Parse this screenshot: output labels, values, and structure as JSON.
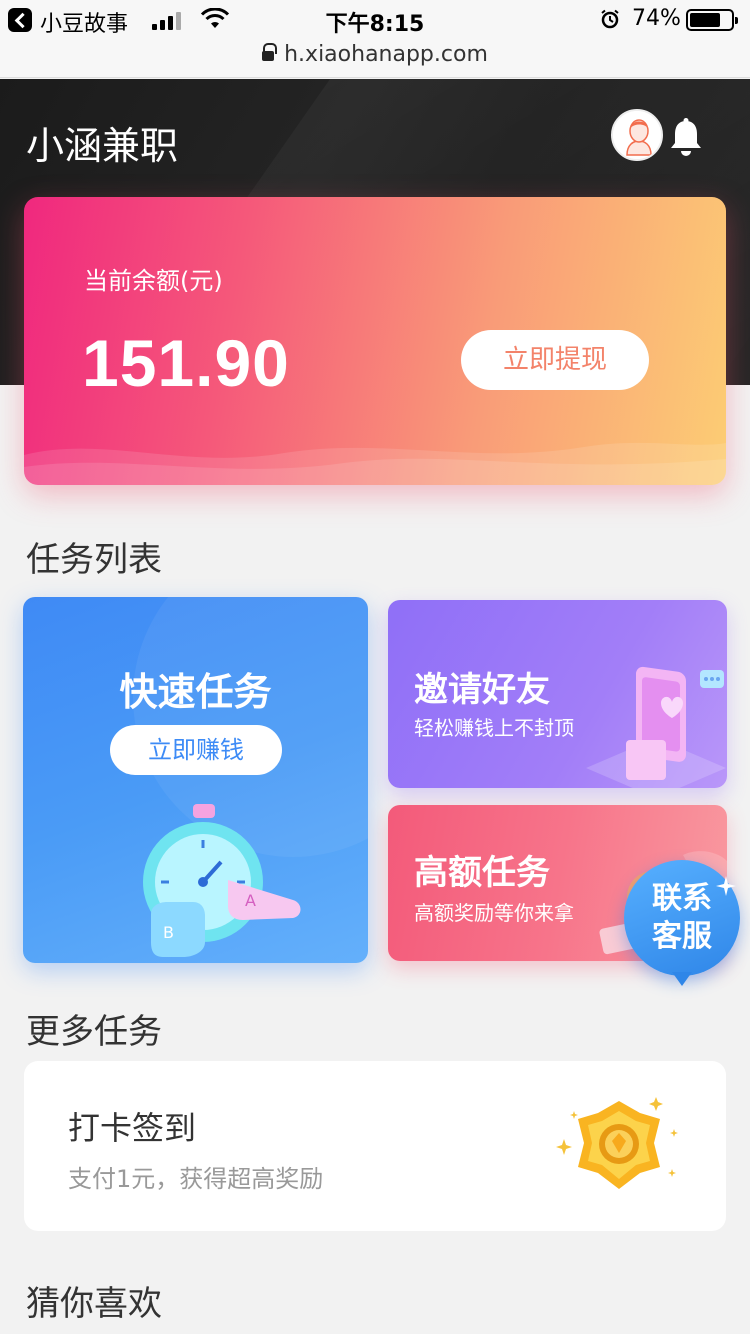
{
  "statusbar": {
    "carrier": "小豆故事",
    "time": "下午8:15",
    "battery_pct": "74%",
    "battery_level": 0.74
  },
  "urlbar": {
    "url": "h.xiaohanapp.com"
  },
  "header": {
    "title": "小涵兼职"
  },
  "balance": {
    "label": "当前余额(元)",
    "value": "151.90",
    "withdraw_label": "立即提现"
  },
  "sections": {
    "tasks": "任务列表",
    "more": "更多任务",
    "guess": "猜你喜欢"
  },
  "tasks": {
    "quick": {
      "title": "快速任务",
      "button": "立即赚钱"
    },
    "invite": {
      "title": "邀请好友",
      "subtitle": "轻松赚钱上不封顶"
    },
    "high": {
      "title": "高额任务",
      "subtitle": "高额奖励等你来拿"
    }
  },
  "customer_service": {
    "line1": "联系",
    "line2": "客服"
  },
  "checkin": {
    "title": "打卡签到",
    "subtitle": "支付1元，获得超高奖励"
  },
  "colors": {
    "balance_gradient_start": "#f0287e",
    "balance_gradient_end": "#fccd74",
    "quick_card": "#4a9bf6",
    "invite_card": "#a27ef8",
    "high_card": "#f7748a",
    "header_bg": "#1e1e1e"
  },
  "icons": [
    "back-icon",
    "signal-icon",
    "wifi-icon",
    "alarm-icon",
    "battery-icon",
    "lock-icon",
    "avatar",
    "bell-icon",
    "sparkle-icon"
  ]
}
